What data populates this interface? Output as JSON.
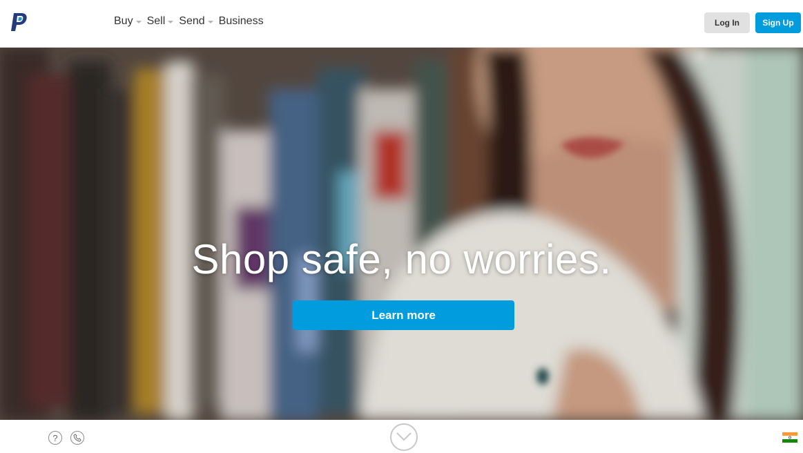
{
  "header": {
    "logo_icon": "paypal-p-logo-icon",
    "nav": [
      {
        "label": "Buy",
        "has_dropdown": true
      },
      {
        "label": "Sell",
        "has_dropdown": true
      },
      {
        "label": "Send",
        "has_dropdown": true
      },
      {
        "label": "Business",
        "has_dropdown": false
      }
    ],
    "login_label": "Log In",
    "signup_label": "Sign Up"
  },
  "hero": {
    "title": "Shop safe, no worries.",
    "cta_label": "Learn more"
  },
  "footer": {
    "help_icon": "help-icon",
    "help_glyph": "?",
    "phone_icon": "phone-icon",
    "scroll_icon": "chevron-down-icon",
    "country_flag": "india-flag-icon"
  },
  "colors": {
    "brand_blue": "#009cde",
    "logo_dark": "#253b80",
    "logo_light": "#179bd7"
  }
}
